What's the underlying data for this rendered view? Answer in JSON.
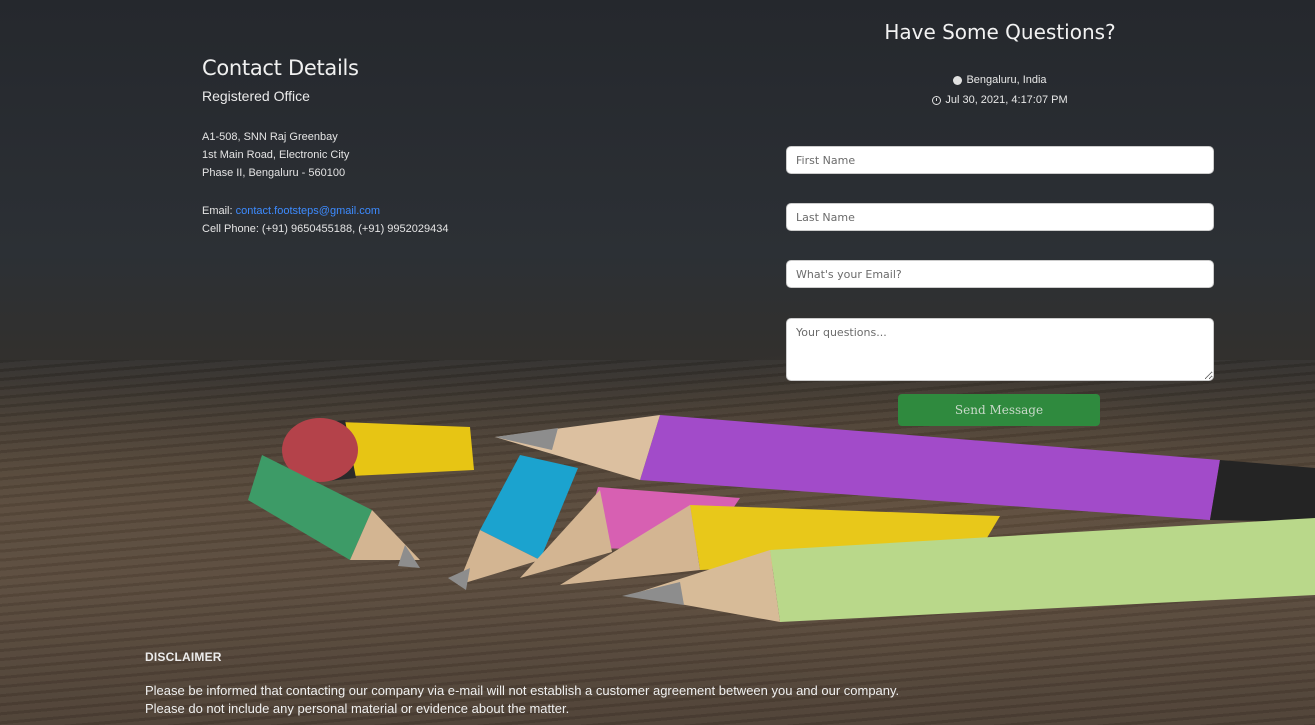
{
  "contact": {
    "title": "Contact Details",
    "subtitle": "Registered Office",
    "address_line1": "A1-508, SNN Raj Greenbay",
    "address_line2": "1st Main Road, Electronic City",
    "address_line3": "Phase II, Bengaluru - 560100",
    "email_label": "Email: ",
    "email_value": "contact.footsteps@gmail.com",
    "phone_line": "Cell Phone: (+91) 9650455188, (+91) 9952029434"
  },
  "form": {
    "title": "Have Some Questions?",
    "location": "Bengaluru, India",
    "datetime": "Jul 30, 2021, 4:17:07 PM",
    "first_name_placeholder": "First Name",
    "last_name_placeholder": "Last Name",
    "email_placeholder": "What's your Email?",
    "questions_placeholder": "Your questions...",
    "send_label": "Send Message"
  },
  "disclaimer": {
    "title": "DISCLAIMER",
    "line1": "Please be informed that contacting our company via e-mail will not establish a customer agreement between you and our company.",
    "line2": "Please do not include any personal material or evidence about the matter."
  },
  "icons": {
    "location_icon": "globe-icon",
    "time_icon": "clock-icon"
  },
  "colors": {
    "link": "#3d8bff",
    "send_button": "#2f8a3e"
  }
}
